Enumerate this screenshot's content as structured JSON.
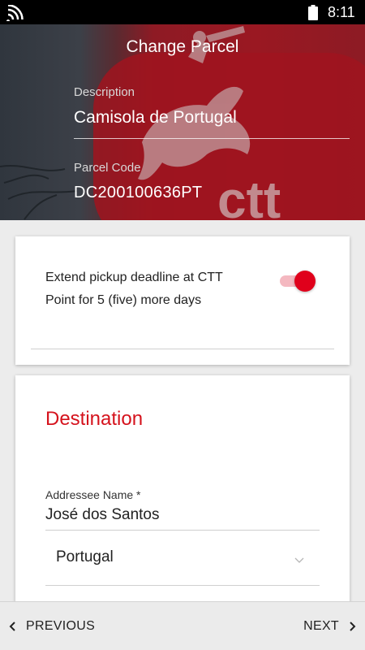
{
  "status_bar": {
    "time": "8:11",
    "icons": [
      "wifi-icon",
      "battery-icon"
    ]
  },
  "header": {
    "title": "Change Parcel",
    "description_label": "Description",
    "description_value": "Camisola de Portugal",
    "parcel_code_label": "Parcel Code",
    "parcel_code_value": "DC200100636PT",
    "background_logo_text": "ctt",
    "colors": {
      "brand_red": "#9a1822",
      "text": "#ffffff"
    }
  },
  "extend_card": {
    "text": "Extend pickup deadline at CTT Point for 5 (five) more days",
    "toggle_on": true,
    "toggle_color": "#e0001b"
  },
  "destination_card": {
    "heading": "Destination",
    "addressee_label": "Addressee Name *",
    "addressee_value": "José dos Santos",
    "country_selected": "Portugal"
  },
  "bottom_nav": {
    "previous_label": "PREVIOUS",
    "next_label": "NEXT"
  }
}
